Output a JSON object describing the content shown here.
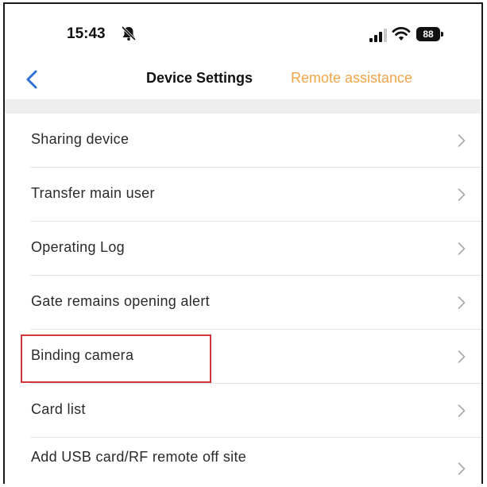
{
  "status_bar": {
    "time": "15:43",
    "battery_level": "88",
    "icons": [
      "bell-muted-icon",
      "signal-icon",
      "wifi-icon",
      "battery-icon"
    ]
  },
  "nav": {
    "back_icon": "chevron-left-icon",
    "title": "Device Settings",
    "action_label": "Remote assistance"
  },
  "settings": {
    "items": [
      {
        "label": "Sharing device"
      },
      {
        "label": "Transfer main user"
      },
      {
        "label": "Operating Log"
      },
      {
        "label": "Gate remains opening alert"
      },
      {
        "label": "Binding camera"
      },
      {
        "label": "Card list"
      },
      {
        "label": "Add USB card/RF remote off site"
      }
    ]
  },
  "colors": {
    "accent": "#f0a548",
    "back_arrow": "#2f6fd6",
    "highlight": "#d2373d",
    "section_gap": "#eeeeee",
    "text": "#2a2a2a"
  }
}
